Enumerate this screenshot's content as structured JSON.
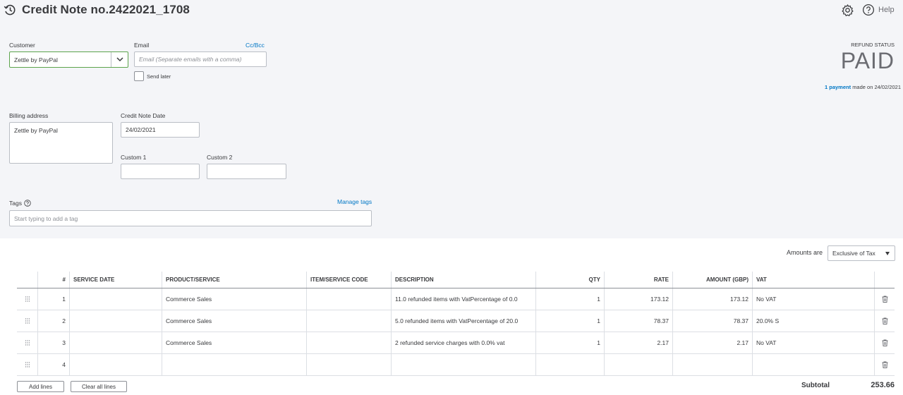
{
  "header": {
    "title": "Credit Note no.2422021_1708",
    "help_label": "Help"
  },
  "form": {
    "customer": {
      "label": "Customer",
      "value": "Zettle by PayPal"
    },
    "email": {
      "label": "Email",
      "placeholder": "Email (Separate emails with a comma)",
      "cc_bcc": "Cc/Bcc"
    },
    "send_later": {
      "label": "Send later",
      "checked": false
    },
    "billing_address": {
      "label": "Billing address",
      "value": "Zettle by PayPal"
    },
    "credit_note_date": {
      "label": "Credit Note Date",
      "value": "24/02/2021"
    },
    "custom1": {
      "label": "Custom 1",
      "value": ""
    },
    "custom2": {
      "label": "Custom 2",
      "value": ""
    },
    "tags": {
      "label": "Tags",
      "placeholder": "Start typing to add a tag",
      "manage_link": "Manage tags"
    }
  },
  "refund_status": {
    "label": "REFUND STATUS",
    "value": "PAID",
    "payment_link": "1 payment",
    "payment_text": "made on 24/02/2021"
  },
  "amounts": {
    "label": "Amounts are",
    "value": "Exclusive of Tax"
  },
  "table": {
    "headers": {
      "num": "#",
      "service_date": "SERVICE DATE",
      "product": "PRODUCT/SERVICE",
      "item_code": "ITEM/SERVICE CODE",
      "description": "DESCRIPTION",
      "qty": "QTY",
      "rate": "RATE",
      "amount": "AMOUNT (GBP)",
      "vat": "VAT"
    },
    "rows": [
      {
        "num": "1",
        "service_date": "",
        "product": "Commerce Sales",
        "item_code": "",
        "description": "11.0 refunded items with VatPercentage of 0.0",
        "qty": "1",
        "rate": "173.12",
        "amount": "173.12",
        "vat": "No VAT"
      },
      {
        "num": "2",
        "service_date": "",
        "product": "Commerce Sales",
        "item_code": "",
        "description": "5.0 refunded items with VatPercentage of 20.0",
        "qty": "1",
        "rate": "78.37",
        "amount": "78.37",
        "vat": "20.0% S"
      },
      {
        "num": "3",
        "service_date": "",
        "product": "Commerce Sales",
        "item_code": "",
        "description": "2 refunded service charges with 0.0% vat",
        "qty": "1",
        "rate": "2.17",
        "amount": "2.17",
        "vat": "No VAT"
      },
      {
        "num": "4",
        "service_date": "",
        "product": "",
        "item_code": "",
        "description": "",
        "qty": "",
        "rate": "",
        "amount": "",
        "vat": ""
      }
    ]
  },
  "footer": {
    "add_lines": "Add lines",
    "clear_lines": "Clear all lines",
    "subtotal_label": "Subtotal",
    "subtotal_value": "253.66"
  },
  "colors": {
    "accent": "#0077c5",
    "focus_green": "#5ca44c",
    "panel_bg": "#f4f5f8"
  }
}
